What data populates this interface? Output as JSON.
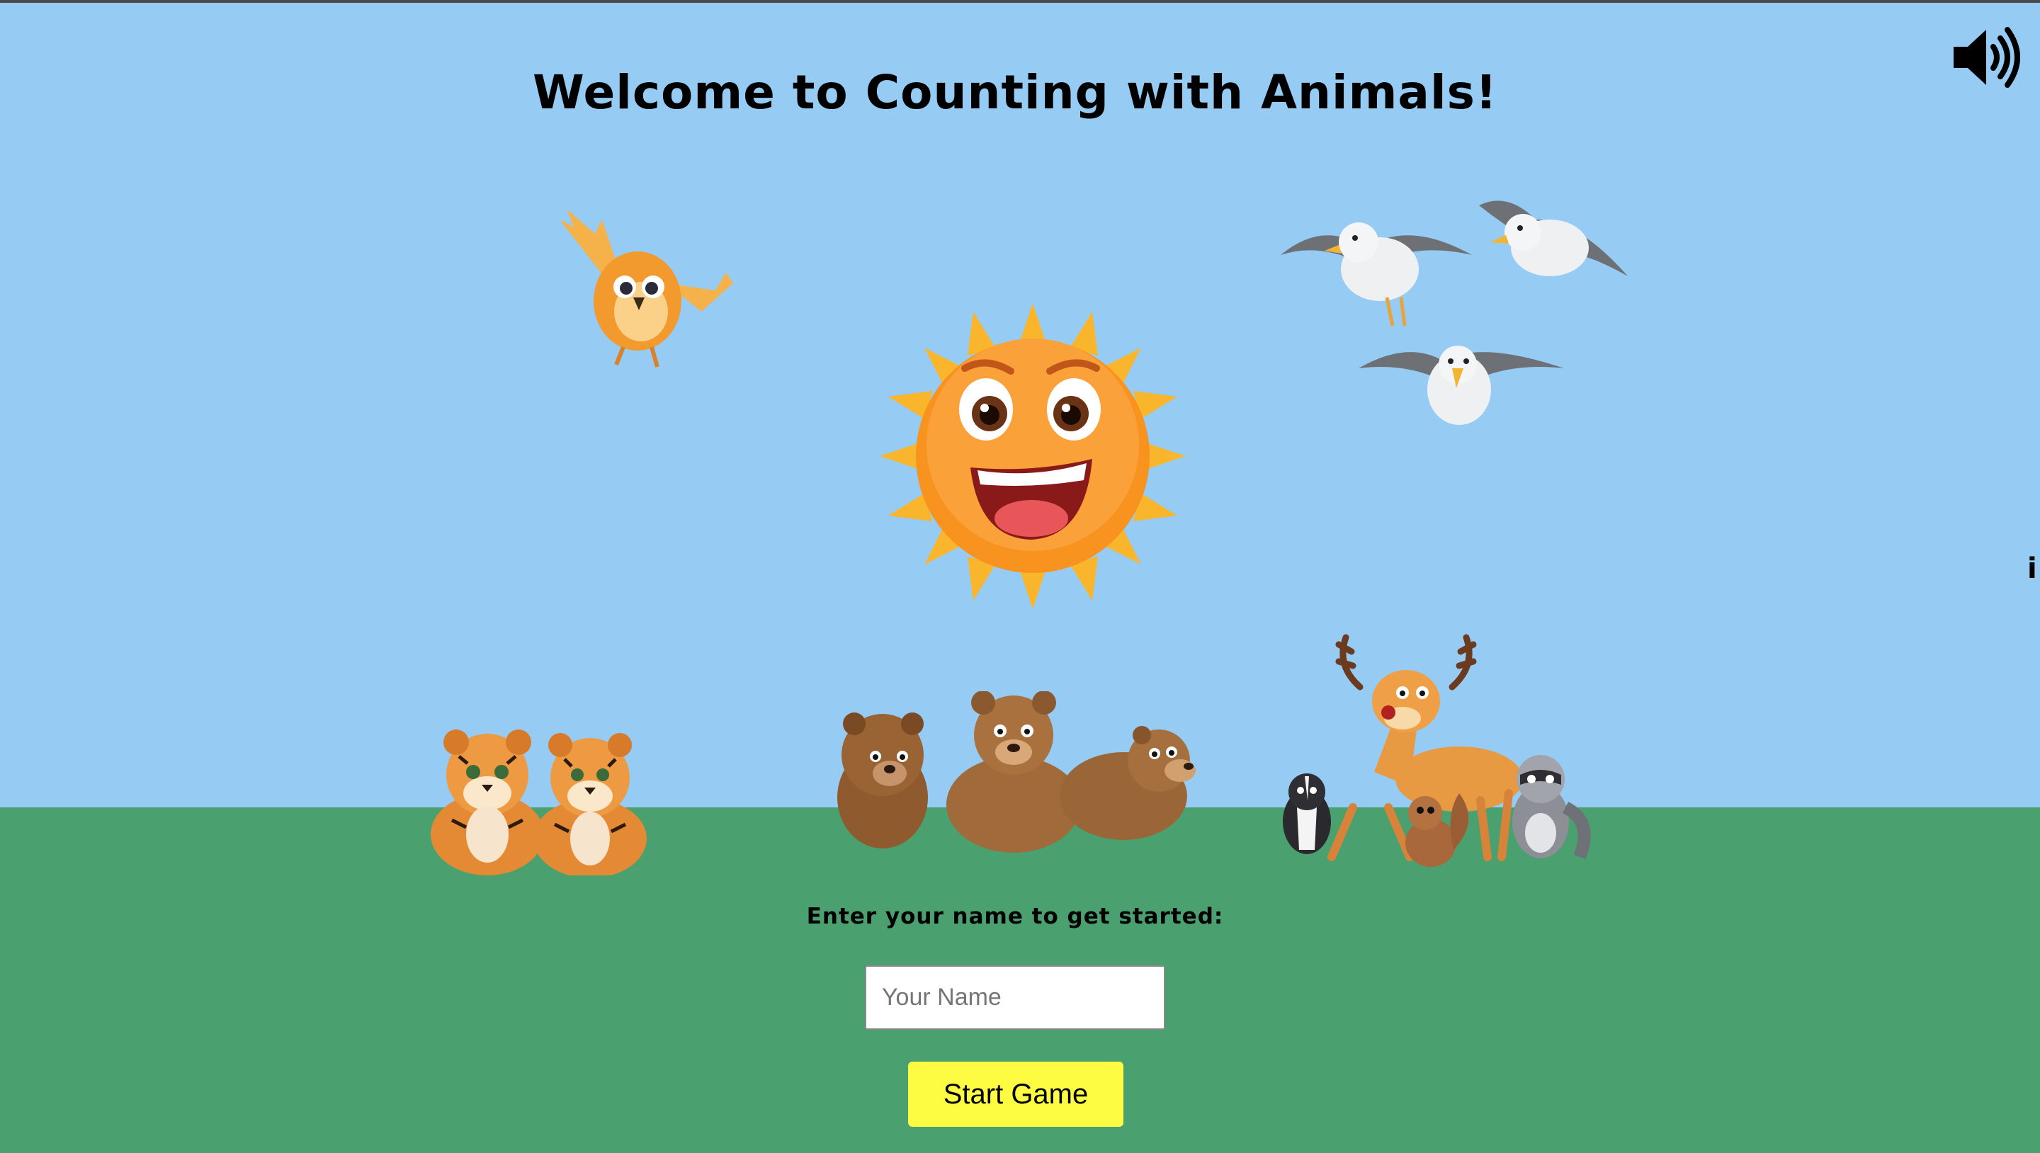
{
  "header": {
    "title": "Welcome to Counting with Animals!",
    "sound_icon": "speaker-volume-icon"
  },
  "edge_glyph": "i",
  "scene": {
    "sky_color": "#96cbf4",
    "ground_color": "#4aa06e",
    "illustrations": [
      "orange-bird",
      "seagulls",
      "smiling-sun",
      "tiger-cubs",
      "brown-bears",
      "deer-skunk-squirrel-raccoon"
    ]
  },
  "form": {
    "prompt": "Enter your name to get started:",
    "name_placeholder": "Your Name",
    "name_value": "",
    "start_label": "Start Game",
    "start_color": "#fdfb42"
  }
}
